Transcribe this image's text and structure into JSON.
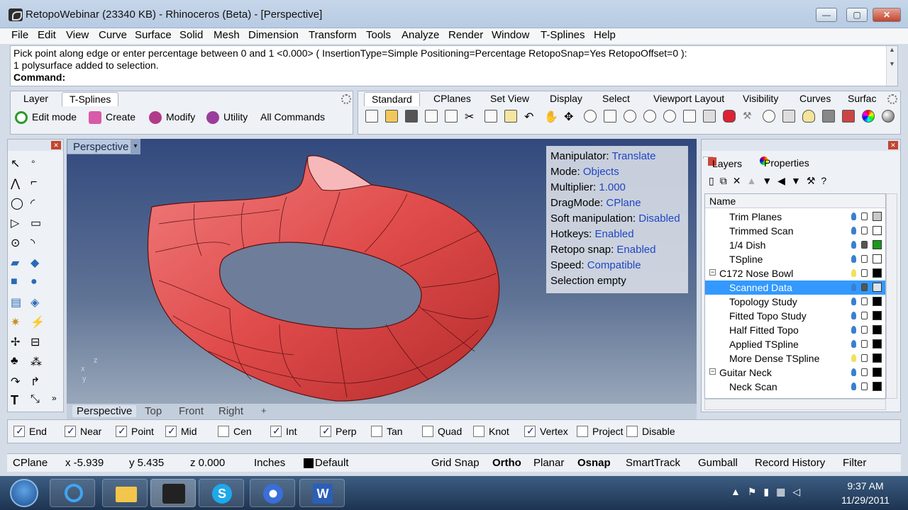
{
  "window": {
    "title": "RetopoWebinar (23340 KB) - Rhinoceros (Beta) - [Perspective]",
    "minimize": "—",
    "maximize": "▢",
    "close": "✕"
  },
  "menu": [
    "File",
    "Edit",
    "View",
    "Curve",
    "Surface",
    "Solid",
    "Mesh",
    "Dimension",
    "Transform",
    "Tools",
    "Analyze",
    "Render",
    "Window",
    "T-Splines",
    "Help"
  ],
  "command": {
    "line1": "Pick point along edge or enter percentage between 0 and 1 <0.000> ( InsertionType=Simple  Positioning=Percentage  RetopoSnap=Yes  RetopoOffset=0 ):",
    "line2": "1 polysurface added to selection.",
    "prompt": "Command:"
  },
  "left_toolbar": {
    "tabs": [
      "Layer",
      "T-Splines"
    ],
    "active_tab": "T-Splines",
    "buttons": [
      "Edit mode",
      "Create",
      "Modify",
      "Utility",
      "All Commands"
    ]
  },
  "main_toolbar": {
    "tabs": [
      "Standard",
      "CPlanes",
      "Set View",
      "Display",
      "Select",
      "Viewport Layout",
      "Visibility",
      "Curves",
      "Surfac"
    ],
    "active_tab": "Standard"
  },
  "viewport": {
    "title": "Perspective",
    "dropdown": "▾",
    "axis_x": "x",
    "axis_y": "y",
    "axis_z": "z",
    "tabs": [
      "Perspective",
      "Top",
      "Front",
      "Right",
      "+"
    ],
    "surface_color": "#e04b4b"
  },
  "hud": {
    "manipulator": {
      "label": "Manipulator:",
      "value": "Translate"
    },
    "mode": {
      "label": "Mode:",
      "value": "Objects"
    },
    "multiplier": {
      "label": "Multiplier:",
      "value": "1.000"
    },
    "dragmode": {
      "label": "DragMode:",
      "value": "CPlane"
    },
    "soft": {
      "label": "Soft manipulation:",
      "value": "Disabled"
    },
    "hotkeys": {
      "label": "Hotkeys:",
      "value": "Enabled"
    },
    "retopo": {
      "label": "Retopo snap:",
      "value": "Enabled"
    },
    "speed": {
      "label": "Speed:",
      "value": "Compatible"
    },
    "selection": "Selection empty"
  },
  "layers_panel": {
    "tabs": [
      "Layers",
      "Properties"
    ],
    "column_name": "Name",
    "rows": [
      {
        "name": "Trim Planes",
        "indent": 1,
        "color": "#c8c8c8",
        "bulb": "on",
        "locked": false
      },
      {
        "name": "Trimmed Scan",
        "indent": 1,
        "color": "#ffffff",
        "bulb": "on",
        "locked": false
      },
      {
        "name": "1/4 Dish",
        "indent": 1,
        "color": "#1a9a1a",
        "bulb": "on",
        "locked": true
      },
      {
        "name": "TSpline",
        "indent": 1,
        "color": "#ffffff",
        "bulb": "on",
        "locked": false
      },
      {
        "name": "C172 Nose Bowl",
        "indent": 0,
        "expand": "−",
        "color": "#000000",
        "bulb": "off",
        "locked": false
      },
      {
        "name": "Scanned Data",
        "indent": 1,
        "color": "#dde3ea",
        "bulb": "on",
        "locked": true,
        "selected": true
      },
      {
        "name": "Topology Study",
        "indent": 1,
        "color": "#000000",
        "bulb": "on",
        "locked": false
      },
      {
        "name": "Fitted Topo Study",
        "indent": 1,
        "color": "#000000",
        "bulb": "on",
        "locked": false
      },
      {
        "name": "Half Fitted Topo",
        "indent": 1,
        "color": "#000000",
        "bulb": "on",
        "locked": false
      },
      {
        "name": "Applied TSpline",
        "indent": 1,
        "color": "#000000",
        "bulb": "on",
        "locked": false
      },
      {
        "name": "More Dense TSpline",
        "indent": 1,
        "color": "#000000",
        "bulb": "off",
        "locked": false
      },
      {
        "name": "Guitar Neck",
        "indent": 0,
        "expand": "−",
        "color": "#000000",
        "bulb": "on",
        "locked": false
      },
      {
        "name": "Neck Scan",
        "indent": 1,
        "color": "#000000",
        "bulb": "on",
        "locked": false
      }
    ]
  },
  "osnap": [
    {
      "label": "End",
      "checked": true
    },
    {
      "label": "Near",
      "checked": true
    },
    {
      "label": "Point",
      "checked": true
    },
    {
      "label": "Mid",
      "checked": true
    },
    {
      "label": "Cen",
      "checked": false
    },
    {
      "label": "Int",
      "checked": true
    },
    {
      "label": "Perp",
      "checked": true
    },
    {
      "label": "Tan",
      "checked": false
    },
    {
      "label": "Quad",
      "checked": false
    },
    {
      "label": "Knot",
      "checked": false
    },
    {
      "label": "Vertex",
      "checked": true
    },
    {
      "label": "Project",
      "checked": false
    },
    {
      "label": "Disable",
      "checked": false
    }
  ],
  "statusbar": {
    "cplane": "CPlane",
    "x": "x -5.939",
    "y": "y 5.435",
    "z": "z 0.000",
    "units": "Inches",
    "layer": "Default",
    "grid_snap": "Grid Snap",
    "ortho": "Ortho",
    "planar": "Planar",
    "osnap": "Osnap",
    "smarttrack": "SmartTrack",
    "gumball": "Gumball",
    "record_history": "Record History",
    "filter": "Filter"
  },
  "taskbar": {
    "time": "9:37 AM",
    "date": "11/29/2011",
    "apps": [
      "internet-explorer",
      "file-explorer",
      "rhinoceros",
      "skype",
      "network-app",
      "word"
    ]
  }
}
